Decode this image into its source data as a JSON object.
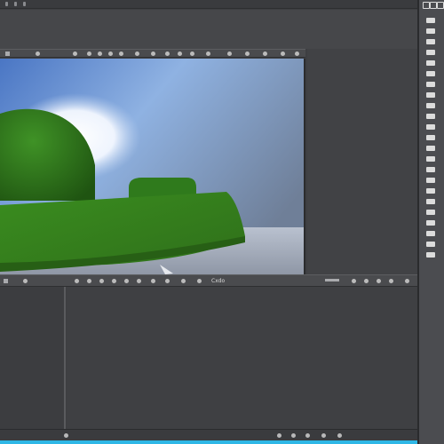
{
  "app": {
    "name": ""
  },
  "viewport": {
    "label": ""
  },
  "timeline": {
    "label": "Cxdo"
  },
  "icons": {
    "viewport_header": [
      "dot-icon",
      "dot-icon",
      "dot-icon",
      "dot-icon",
      "dot-icon",
      "dot-icon",
      "dot-icon",
      "dot-icon",
      "dot-icon",
      "dot-icon",
      "dot-icon",
      "dot-icon",
      "dot-icon",
      "dot-icon",
      "dot-icon",
      "dot-icon",
      "dot-icon",
      "dot-icon"
    ],
    "timeline_header": [
      "play-icon",
      "step-icon",
      "key-icon",
      "loop-icon",
      "gear-icon",
      "camera-icon",
      "render-icon"
    ],
    "toolstrip": [
      "move-icon",
      "rotate-icon",
      "scale-icon",
      "select-icon",
      "brush-icon",
      "eraser-icon",
      "layers-icon",
      "camera-icon"
    ]
  },
  "colors": {
    "accent": "#2fb7e6",
    "grass": "#3d8a24",
    "sky": "#7fa6d8"
  }
}
